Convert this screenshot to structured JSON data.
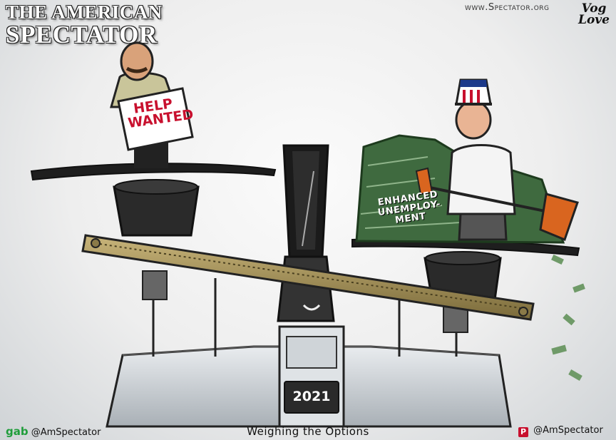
{
  "masthead": {
    "line1": "THE AMERICAN",
    "line2": "SPECTATOR"
  },
  "website": "www.Spectator.org",
  "signature": {
    "line1": "Vog",
    "line2": "Love"
  },
  "sign_text": "HELP WANTED",
  "money_label": "ENHANCED UNEMPLOY-MENT",
  "year": "2021",
  "footer": {
    "gab_logo": "gab",
    "gab_handle": "@AmSpectator",
    "caption": "Weighing the Options",
    "parler_logo": "P",
    "parler_handle": "@AmSpectator"
  },
  "icons": [
    "gab-logo",
    "parler-icon"
  ],
  "colors": {
    "sign_red": "#c8102e",
    "money_green": "#3f6a3f",
    "gab_green": "#1f9d3a",
    "parler_red": "#c8102e"
  }
}
